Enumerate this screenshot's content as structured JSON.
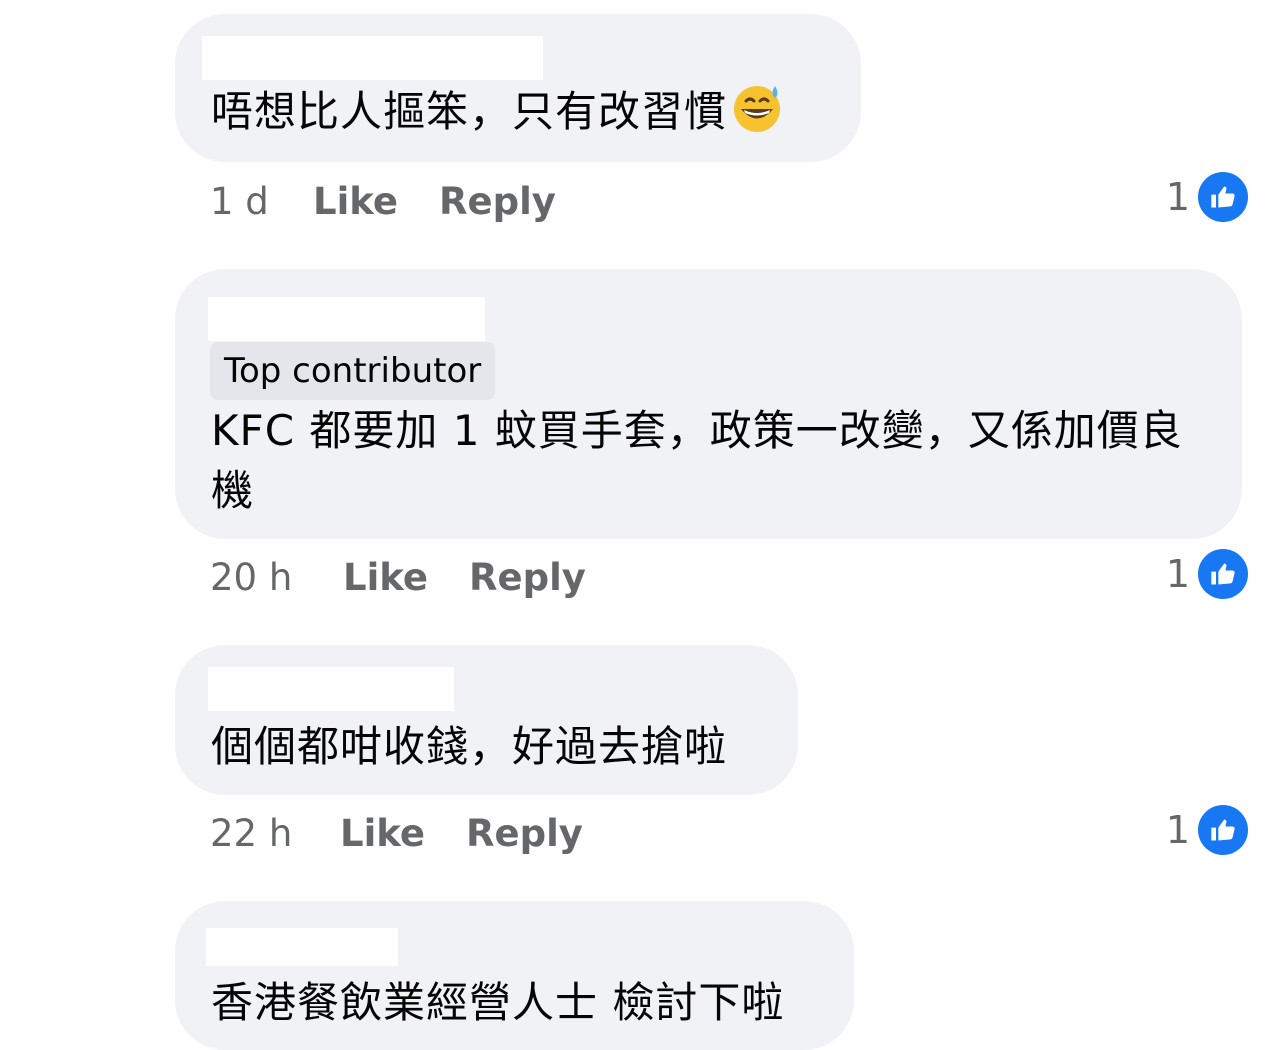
{
  "comments": [
    {
      "text": "唔想比人摳笨，只有改習慣",
      "emoji": "grinning-sweat-emoji",
      "time": "1 d",
      "like_label": "Like",
      "reply_label": "Reply",
      "reactions": "1"
    },
    {
      "badge": "Top contributor",
      "text": "KFC 都要加 1 蚊買手套，政策一改變，又係加價良機",
      "time": "20 h",
      "like_label": "Like",
      "reply_label": "Reply",
      "reactions": "1"
    },
    {
      "text": "個個都咁收錢，好過去搶啦",
      "time": "22 h",
      "like_label": "Like",
      "reply_label": "Reply",
      "reactions": "1"
    },
    {
      "text": "香港餐飲業經營人士 檢討下啦"
    }
  ],
  "colors": {
    "bubble": "#f0f2f5",
    "meta_text": "#65676b",
    "like_blue": "#1877f2",
    "badge_bg": "#e4e6eb"
  }
}
